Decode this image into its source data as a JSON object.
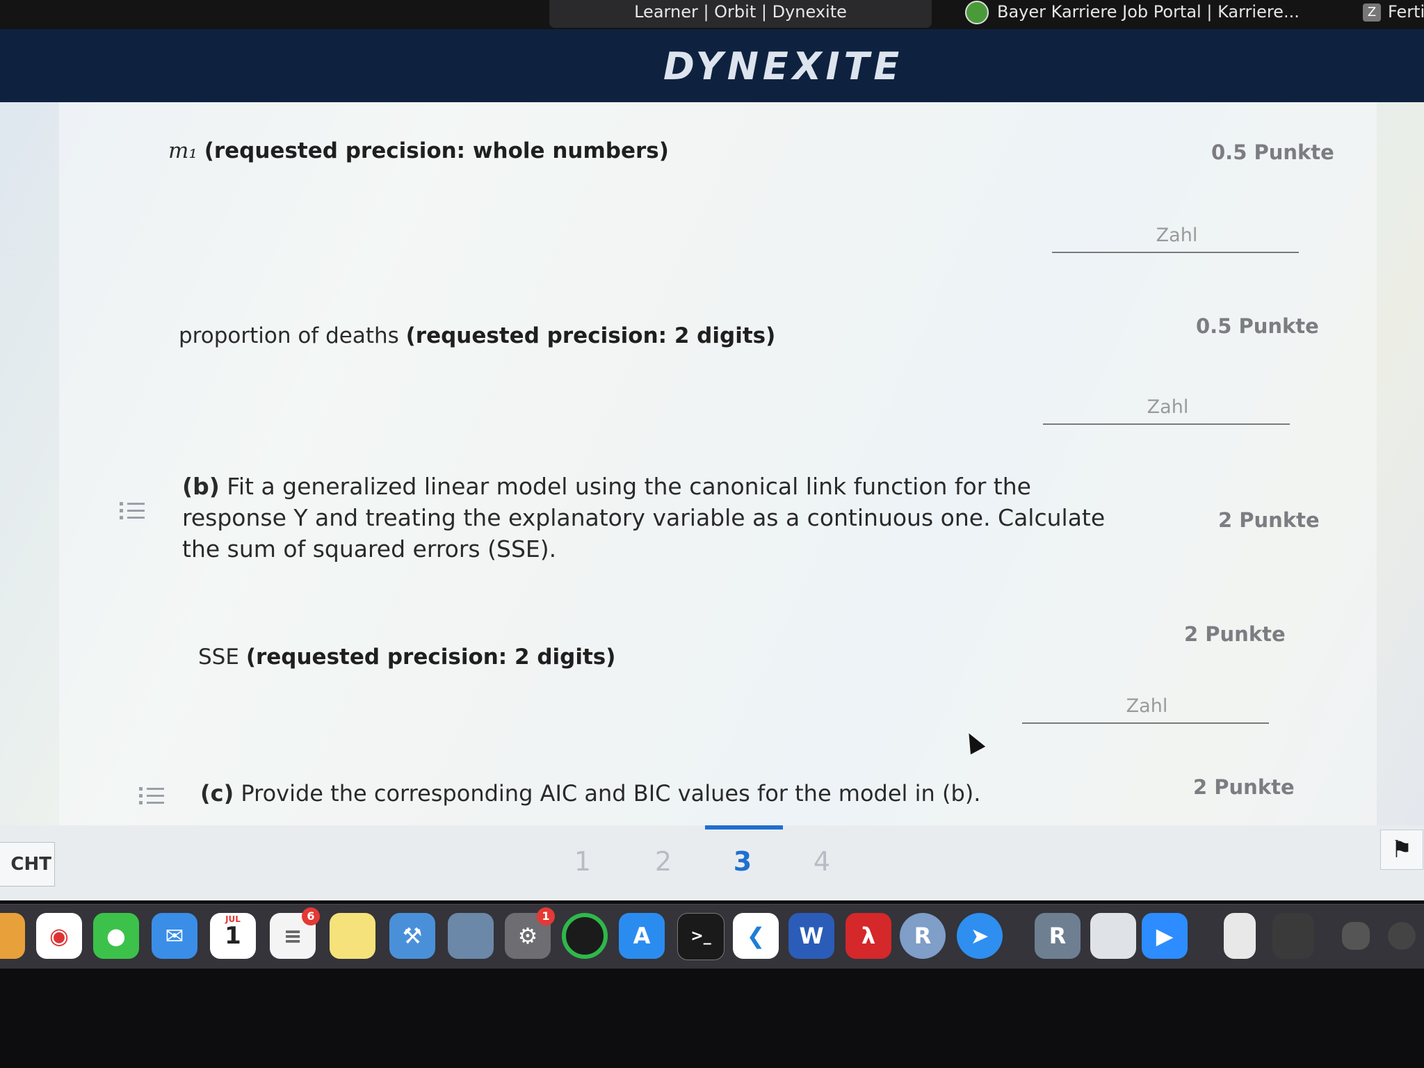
{
  "tabs": {
    "active": "Learner | Orbit | Dynexite",
    "bayer": "Bayer Karriere Job Portal | Karriere...",
    "partial": "Fertig",
    "partial_badge": "Z"
  },
  "header": {
    "logo": "DYNEXITE"
  },
  "questions": {
    "m1": {
      "symbol": "m₁",
      "precision": "(requested precision: whole numbers)",
      "points": "0.5 Punkte",
      "placeholder": "Zahl"
    },
    "deaths": {
      "label": "proportion of deaths",
      "precision": "(requested precision: 2 digits)",
      "points": "0.5 Punkte",
      "placeholder": "Zahl"
    },
    "b": {
      "letter": "(b)",
      "text": "Fit a generalized linear model using the canonical link function for the response Y and treating the explanatory variable as a continuous one. Calculate the sum of squared errors (SSE).",
      "points": "2 Punkte"
    },
    "sse": {
      "label": "SSE",
      "precision": "(requested precision: 2 digits)",
      "points": "2 Punkte",
      "placeholder": "Zahl"
    },
    "c": {
      "letter": "(c)",
      "text": "Provide the corresponding AIC and BIC values for the model in (b).",
      "points": "2 Punkte"
    }
  },
  "footer": {
    "lang": "CHT",
    "pages": [
      "1",
      "2",
      "3",
      "4"
    ],
    "active_page": "3"
  },
  "dock": {
    "calendar_month": "JUL",
    "calendar_day": "1",
    "reminders_badge": "6",
    "settings_badge": "1",
    "word_letter": "W",
    "r_letter": "R"
  },
  "colors": {
    "accent": "#1f6fd0",
    "header": "#0e2240"
  }
}
